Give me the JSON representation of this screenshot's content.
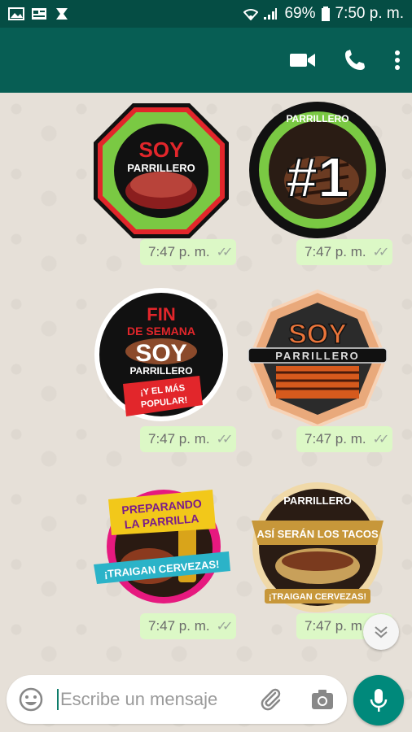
{
  "status_bar": {
    "battery_pct": "69%",
    "time": "7:50 p. m."
  },
  "app_bar": {
    "icons": [
      "video-call-icon",
      "voice-call-icon",
      "more-options-icon"
    ]
  },
  "messages": [
    {
      "kind": "sticker",
      "text_lines": [
        "SOY",
        "PARRILLERO"
      ],
      "time": "7:47 p. m."
    },
    {
      "kind": "sticker",
      "text_lines": [
        "PARRILLERO",
        "#1"
      ],
      "time": "7:47 p. m."
    },
    {
      "kind": "sticker",
      "text_lines": [
        "FIN",
        "DE SEMANA",
        "SOY",
        "PARRILLERO",
        "¡Y EL MÁS",
        "POPULAR!"
      ],
      "time": "7:47 p. m."
    },
    {
      "kind": "sticker",
      "text_lines": [
        "SOY",
        "PARRILLERO"
      ],
      "time": "7:47 p. m."
    },
    {
      "kind": "sticker",
      "text_lines": [
        "PREPARANDO",
        "LA PARRILLA",
        "¡TRAIGAN CERVEZAS!"
      ],
      "time": "7:47 p. m."
    },
    {
      "kind": "sticker",
      "text_lines": [
        "PARRILLERO",
        "ASÍ SERÁN LOS TACOS",
        "¡TRAIGAN CERVEZAS!"
      ],
      "time": "7:47 p. m."
    }
  ],
  "composer": {
    "placeholder": "Escribe un mensaje"
  },
  "colors": {
    "header": "#075e54",
    "status": "#054d44",
    "bubble": "#dcf8c6",
    "fab": "#00897b"
  }
}
